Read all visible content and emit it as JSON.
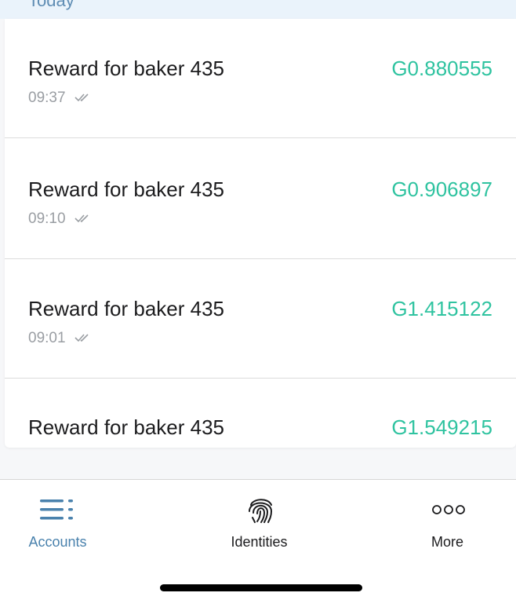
{
  "section": {
    "header": "Today"
  },
  "transactions": [
    {
      "title": "Reward for baker 435",
      "amount": "G0.880555",
      "time": "09:37"
    },
    {
      "title": "Reward for baker 435",
      "amount": "G0.906897",
      "time": "09:10"
    },
    {
      "title": "Reward for baker 435",
      "amount": "G1.415122",
      "time": "09:01"
    },
    {
      "title": "Reward for baker 435",
      "amount": "G1.549215",
      "time": ""
    }
  ],
  "tabbar": {
    "accounts": {
      "label": "Accounts",
      "icon": "accounts-list-icon",
      "active": true
    },
    "identities": {
      "label": "Identities",
      "icon": "fingerprint-icon"
    },
    "more": {
      "label": "More",
      "icon": "more-dots-icon"
    }
  },
  "colors": {
    "amount": "#2fc3a0",
    "active_tab": "#4a82ad",
    "header_bg": "#eaf3fb"
  }
}
